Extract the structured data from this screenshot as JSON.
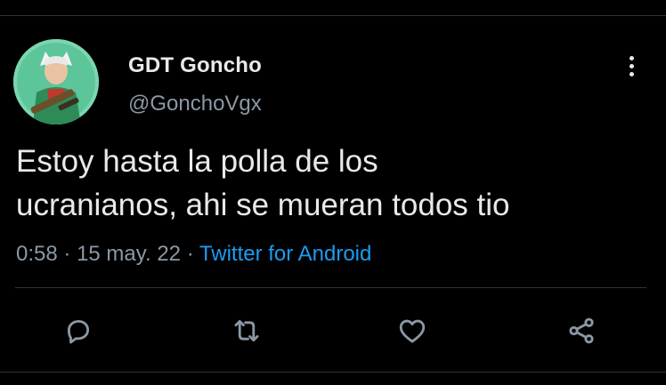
{
  "user": {
    "display_name": "GDT Goncho",
    "handle": "@GonchoVgx"
  },
  "tweet": {
    "text": "Estoy hasta la polla de los\nucranianos, ahi se mueran todos tio",
    "time": "0:58",
    "separator": "·",
    "date": "15 may. 22",
    "source": "Twitter for Android"
  },
  "icons": {
    "more": "more-vertical-icon",
    "reply": "reply-icon",
    "retweet": "retweet-icon",
    "like": "heart-icon",
    "share": "share-icon"
  },
  "colors": {
    "background": "#000000",
    "text": "#e7e9ea",
    "muted": "#8b98a5",
    "link": "#1d9bf0"
  }
}
